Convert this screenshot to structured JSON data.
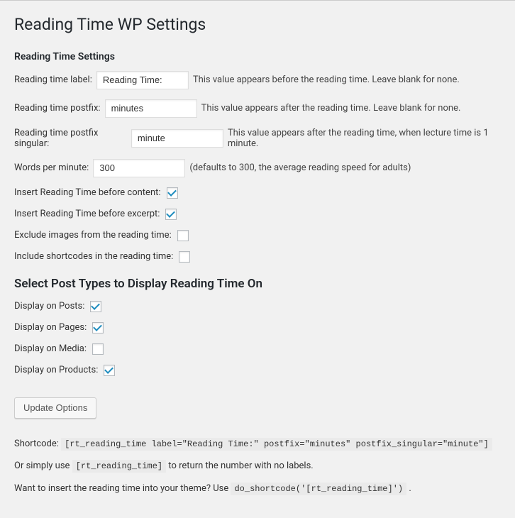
{
  "page": {
    "title": "Reading Time WP Settings",
    "section_heading": "Reading Time Settings",
    "post_types_heading": "Select Post Types to Display Reading Time On"
  },
  "fields": {
    "label": {
      "label": "Reading time label:",
      "value": "Reading Time:",
      "desc": "This value appears before the reading time. Leave blank for none."
    },
    "postfix": {
      "label": "Reading time postfix:",
      "value": "minutes",
      "desc": "This value appears after the reading time. Leave blank for none."
    },
    "postfix_singular": {
      "label": "Reading time postfix singular:",
      "value": "minute",
      "desc": "This value appears after the reading time, when lecture time is 1 minute."
    },
    "wpm": {
      "label": "Words per minute:",
      "value": "300",
      "desc": "(defaults to 300, the average reading speed for adults)"
    },
    "insert_content": {
      "label": "Insert Reading Time before content:",
      "checked": true
    },
    "insert_excerpt": {
      "label": "Insert Reading Time before excerpt:",
      "checked": true
    },
    "exclude_images": {
      "label": "Exclude images from the reading time:",
      "checked": false
    },
    "include_shortcodes": {
      "label": "Include shortcodes in the reading time:",
      "checked": false
    }
  },
  "post_types": {
    "posts": {
      "label": "Display on Posts:",
      "checked": true
    },
    "pages": {
      "label": "Display on Pages:",
      "checked": true
    },
    "media": {
      "label": "Display on Media:",
      "checked": false
    },
    "products": {
      "label": "Display on Products:",
      "checked": true
    }
  },
  "submit": {
    "label": "Update Options"
  },
  "footer": {
    "shortcode_label": "Shortcode: ",
    "shortcode_code": "[rt_reading_time label=\"Reading Time:\" postfix=\"minutes\" postfix_singular=\"minute\"]",
    "simple_pre": "Or simply use ",
    "simple_code": "[rt_reading_time]",
    "simple_post": " to return the number with no labels.",
    "theme_pre": "Want to insert the reading time into your theme? Use ",
    "theme_code": "do_shortcode('[rt_reading_time]')",
    "theme_post": " ."
  }
}
